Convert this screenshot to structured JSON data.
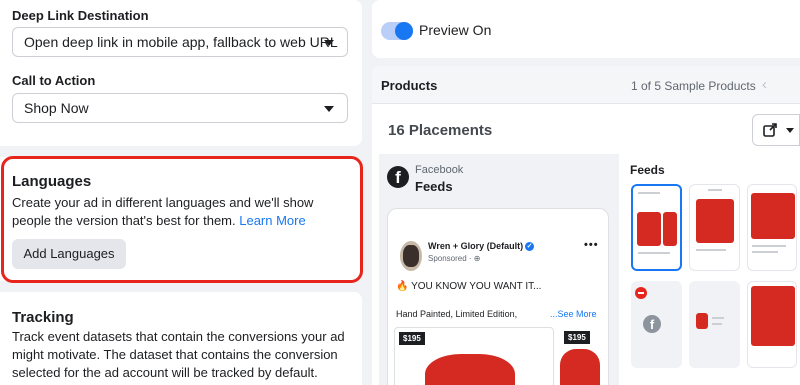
{
  "deep_link": {
    "label": "Deep Link Destination",
    "value": "Open deep link in mobile app, fallback to web URL"
  },
  "call_to_action": {
    "label": "Call to Action",
    "value": "Shop Now"
  },
  "languages": {
    "title": "Languages",
    "description": "Create your ad in different languages and we'll show people the version that's best for them.",
    "learn_more": "Learn More",
    "add_button": "Add Languages"
  },
  "tracking": {
    "title": "Tracking",
    "description": "Track event datasets that contain the conversions your ad might motivate. The dataset that contains the conversion selected for the ad account will be tracked by default."
  },
  "preview": {
    "toggle_label": "Preview On",
    "toggle_on": true
  },
  "products": {
    "title": "Products",
    "sample_count": "1 of 5 Sample Products",
    "placements_label": "16 Placements"
  },
  "facebook_feed": {
    "platform": "Facebook",
    "placement": "Feeds"
  },
  "post": {
    "page_name": "Wren + Glory (Default)",
    "sponsored": "Sponsored · ⊕",
    "headline": "YOU KNOW YOU WANT IT...",
    "body": "Hand Painted, Limited Edition,",
    "see_more": "...See More",
    "price_1": "$195",
    "price_2": "$195"
  },
  "feeds_panel": {
    "title": "Feeds"
  },
  "icons": {
    "facebook": "facebook-icon",
    "share": "external-share-icon",
    "prev": "chevron-left-icon",
    "more": "more-dots-icon",
    "verified": "verified-badge-icon",
    "blocked": "no-entry-icon"
  },
  "colors": {
    "accent": "#1877f2",
    "highlight": "#e8251c",
    "product": "#d42a22"
  }
}
